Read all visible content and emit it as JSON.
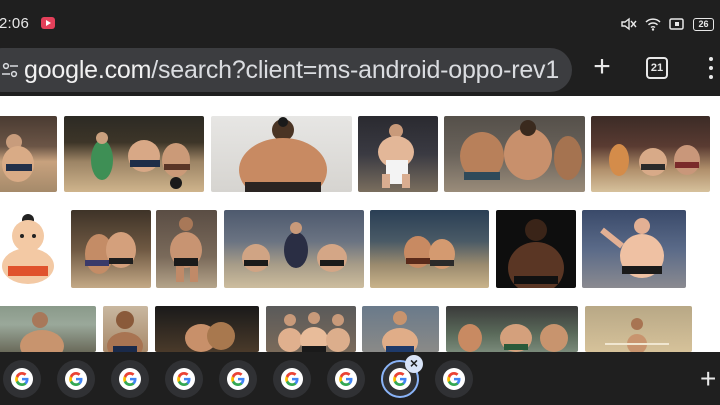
{
  "status_bar": {
    "time": "2:06",
    "icons": [
      "screen-record-icon",
      "mute-vibrate-icon",
      "wifi-icon",
      "cast-icon",
      "battery-icon"
    ],
    "battery_level": "26"
  },
  "toolbar": {
    "url_host": "google.com",
    "url_path": "/search?client=ms-android-oppo-rev1",
    "new_tab_label": "+",
    "tab_count": "21",
    "icons": [
      "site-settings-icon",
      "plus-icon",
      "tab-switcher-icon",
      "more-vert-icon"
    ]
  },
  "results": {
    "query_topic": "sumo wrestler image results",
    "tiles": [
      {
        "name": "result-image-1",
        "desc": "sumo wrestlers in ring"
      },
      {
        "name": "result-image-2",
        "desc": "sumo bout with referee"
      },
      {
        "name": "result-image-3",
        "desc": "sumo wrestler portrait"
      },
      {
        "name": "result-image-4",
        "desc": "sumo wrestler stance"
      },
      {
        "name": "result-image-5",
        "desc": "two sumo wrestlers clash"
      },
      {
        "name": "result-image-6",
        "desc": "sumo tournament bout"
      },
      {
        "name": "result-image-7",
        "desc": "sumo cartoon illustration"
      },
      {
        "name": "result-image-8",
        "desc": "sumo wrestlers grappling"
      },
      {
        "name": "result-image-9",
        "desc": "sumo wrestler standing"
      },
      {
        "name": "result-image-10",
        "desc": "sumo match crowd"
      },
      {
        "name": "result-image-11",
        "desc": "sumo bout arena"
      },
      {
        "name": "result-image-12",
        "desc": "sumo wrestler dark background"
      },
      {
        "name": "result-image-13",
        "desc": "sumo wrestler celebrating"
      },
      {
        "name": "result-image-14",
        "desc": "sumo wrestler outdoors"
      },
      {
        "name": "result-image-15",
        "desc": "sumo wrestler close-up"
      },
      {
        "name": "result-image-16",
        "desc": "sumo bout push"
      },
      {
        "name": "result-image-17",
        "desc": "sumo wrestlers group"
      },
      {
        "name": "result-image-18",
        "desc": "sumo wrestler portrait 2"
      },
      {
        "name": "result-image-19",
        "desc": "sumo wrestlers training"
      },
      {
        "name": "result-image-20",
        "desc": "sumo wrestler ring center"
      }
    ]
  },
  "tab_strip": {
    "tab_count": 9,
    "active_index": 7,
    "add_label": "+",
    "close_label": "×",
    "tab_icon": "google-g-icon"
  },
  "colors": {
    "chrome_bg": "#1f1f1f",
    "omnibox_bg": "#3c3d40",
    "accent": "#8ab4f8",
    "record": "#e4405a"
  }
}
